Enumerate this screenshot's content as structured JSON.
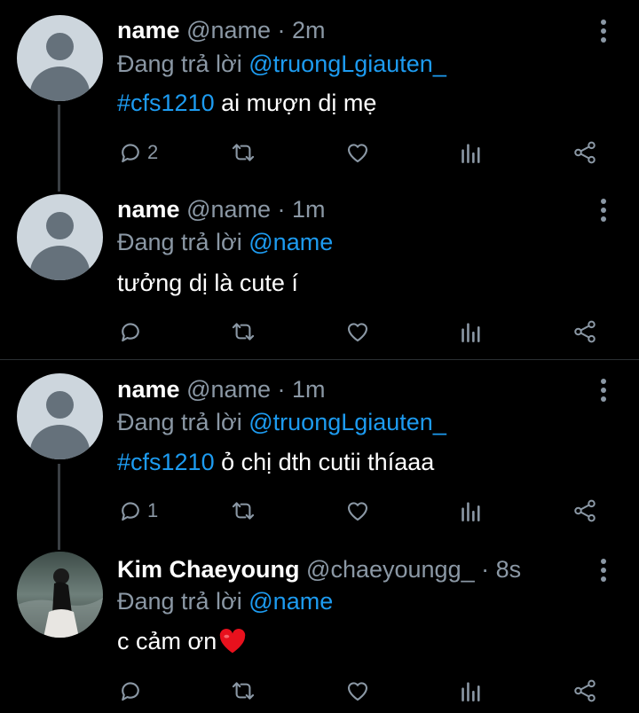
{
  "tweets": [
    {
      "name": "name",
      "handle": "@name",
      "time": "· 2m",
      "reply_prefix": "Đang trả lời ",
      "reply_to": "@truongLgiauten_",
      "hashtag": "#cfs1210",
      "text": " ai mượn dị mẹ",
      "reply_count": "2"
    },
    {
      "name": "name",
      "handle": "@name",
      "time": "· 1m",
      "reply_prefix": "Đang trả lời ",
      "reply_to": "@name",
      "hashtag": "",
      "text": "tưởng dị là cute í",
      "reply_count": ""
    },
    {
      "name": "name",
      "handle": "@name",
      "time": "· 1m",
      "reply_prefix": "Đang trả lời ",
      "reply_to": "@truongLgiauten_",
      "hashtag": "#cfs1210",
      "text": " ỏ chị dth cutii thíaaa",
      "reply_count": "1"
    },
    {
      "name": "Kim Chaeyoung",
      "handle": "@chaeyoungg_",
      "time": "· 8s",
      "reply_prefix": "Đang trả lời ",
      "reply_to": "@name",
      "hashtag": "",
      "text": "c cảm ơn",
      "emoji": "heart",
      "reply_count": ""
    }
  ],
  "icons": {
    "reply": "reply-icon",
    "retweet": "retweet-icon",
    "like": "heart-icon",
    "views": "analytics-icon",
    "share": "share-icon",
    "more": "more-options-icon"
  },
  "colors": {
    "background": "#000000",
    "muted": "#8b98a5",
    "accent": "#1d9bf0",
    "emoji_heart": "#e8111d"
  }
}
